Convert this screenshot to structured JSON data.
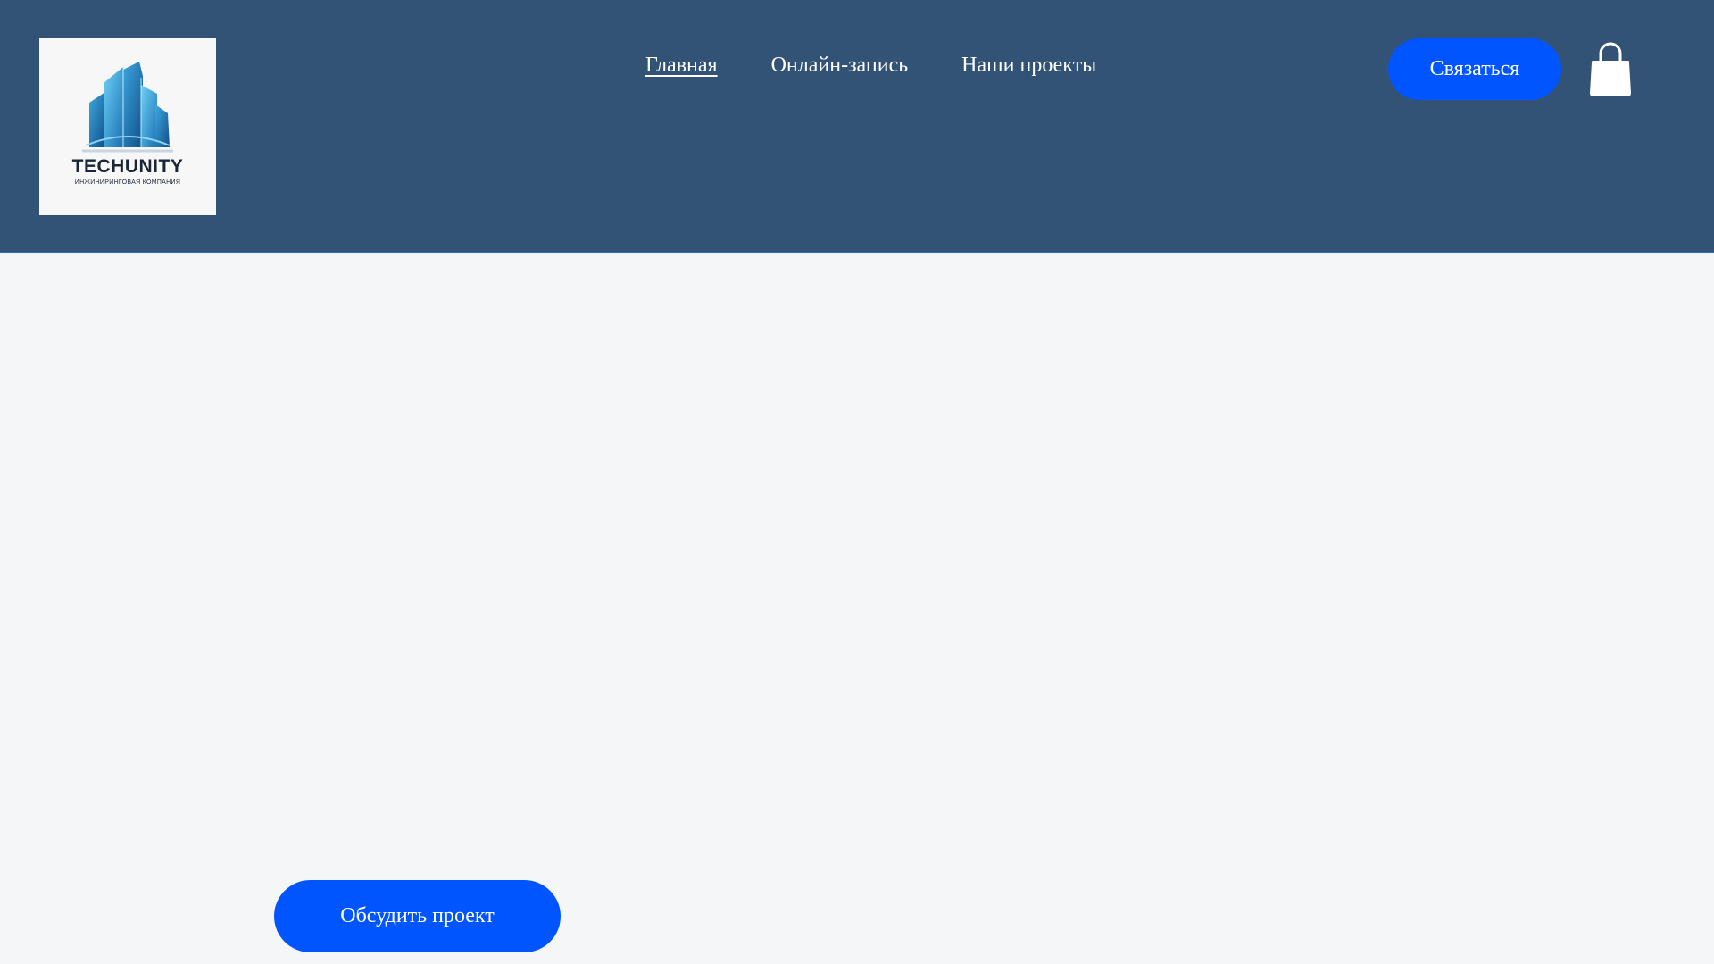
{
  "header": {
    "logo": {
      "name": "TECHUNITY",
      "tagline": "Инжиниринговая компания"
    },
    "nav": {
      "items": [
        {
          "label": "Главная",
          "active": true
        },
        {
          "label": "Онлайн-запись",
          "active": false
        },
        {
          "label": "Наши проекты",
          "active": false
        }
      ]
    },
    "contact_button": "Связаться",
    "cart_icon": "shopping-bag-icon"
  },
  "main": {
    "cta_button": "Обсудить проект"
  },
  "colors": {
    "header_bg": "#325375",
    "accent": "#0055ff",
    "page_bg": "#f5f6f8"
  }
}
